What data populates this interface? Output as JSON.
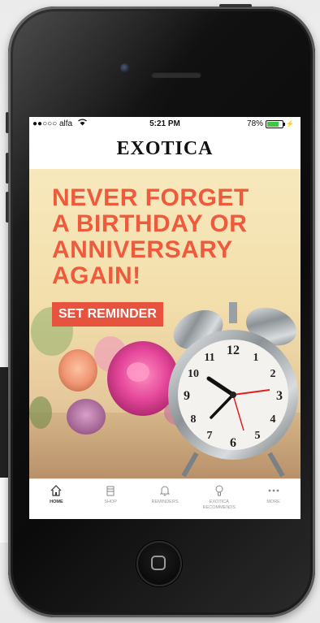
{
  "status_bar": {
    "carrier": "●●○○○ alfa",
    "wifi_icon": "wifi-icon",
    "time": "5:21 PM",
    "battery_percent": "78%",
    "battery_level": 0.78
  },
  "header": {
    "logo": "EXOTICA"
  },
  "banner": {
    "headline": [
      "NEVER FORGET",
      "A BIRTHDAY OR",
      "ANNIVERSARY",
      "AGAIN!"
    ],
    "cta_label": "SET REMINDER"
  },
  "tab_bar": {
    "items": [
      {
        "label": "HOME",
        "icon": "home-icon",
        "active": true
      },
      {
        "label": "SHOP",
        "icon": "shop-icon",
        "active": false
      },
      {
        "label": "REMINDERS",
        "icon": "bell-icon",
        "active": false
      },
      {
        "label": "EXOTICA RECOMMENDS",
        "icon": "lightbulb-icon",
        "active": false
      },
      {
        "label": "MORE",
        "icon": "more-dots-icon",
        "active": false
      }
    ]
  },
  "colors": {
    "accent": "#ef5a3c",
    "button": "#e8533e",
    "banner_bg": "#f2deaa",
    "phone_body": "#111111"
  }
}
